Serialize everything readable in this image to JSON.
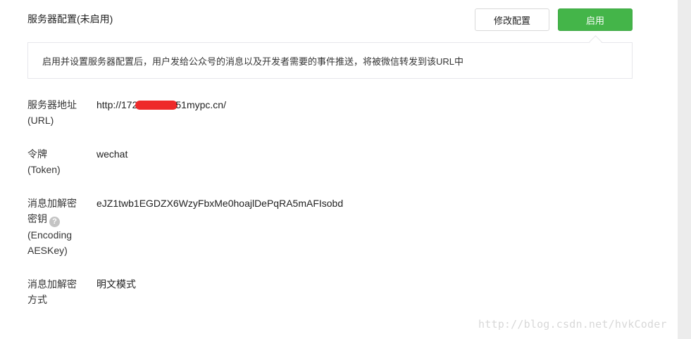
{
  "header": {
    "title": "服务器配置(未启用)",
    "modify_label": "修改配置",
    "enable_label": "启用"
  },
  "notice": {
    "text": "启用并设置服务器配置后，用户发给公众号的消息以及开发者需要的事件推送，将被微信转发到该URL中"
  },
  "fields": {
    "url": {
      "label_line1": "服务器地址",
      "label_line2": "(URL)",
      "value_prefix": "http://172",
      "value_suffix": "51mypc.cn/"
    },
    "token": {
      "label_line1": "令牌",
      "label_line2": "(Token)",
      "value": "wechat"
    },
    "aes_key": {
      "label_line1": "消息加解密",
      "label_line2": "密钥",
      "label_line3": "(Encoding",
      "label_line4": "AESKey)",
      "value": "eJZ1twb1EGDZX6WzyFbxMe0hoajlDePqRA5mAFIsobd"
    },
    "encrypt_mode": {
      "label_line1": "消息加解密",
      "label_line2": "方式",
      "value": "明文模式"
    }
  },
  "icons": {
    "help": "question-circle-icon",
    "help_glyph": "?"
  },
  "colors": {
    "primary_green": "#44b549",
    "border": "#e7e7eb",
    "redaction": "#ee2a2a"
  },
  "watermark": {
    "text": "http://blog.csdn.net/hvkCoder"
  }
}
